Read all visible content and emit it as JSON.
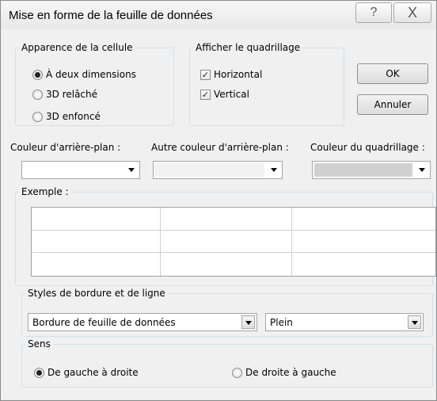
{
  "window": {
    "title": "Mise en forme de la feuille de données",
    "help_icon": "?",
    "close_icon": "X"
  },
  "cell_appearance": {
    "legend": "Apparence de la cellule",
    "options": [
      {
        "label": "À deux dimensions",
        "selected": true
      },
      {
        "label": "3D relâché",
        "selected": false
      },
      {
        "label": "3D enfoncé",
        "selected": false
      }
    ]
  },
  "gridlines": {
    "legend": "Afficher le quadrillage",
    "options": [
      {
        "label": "Horizontal",
        "checked": true
      },
      {
        "label": "Vertical",
        "checked": true
      }
    ]
  },
  "buttons": {
    "ok": "OK",
    "cancel": "Annuler"
  },
  "colors": {
    "background_label": "Couleur d'arrière-plan :",
    "background_value": "#ffffff",
    "alt_background_label": "Autre couleur d'arrière-plan :",
    "alt_background_value": "#f2f2f2",
    "gridline_label": "Couleur du quadrillage :",
    "gridline_value": "#d0d0d0"
  },
  "example": {
    "legend": "Exemple :"
  },
  "border_styles": {
    "legend": "Styles de bordure et de ligne",
    "border_select": "Bordure de feuille de données",
    "line_select": "Plein"
  },
  "direction": {
    "legend": "Sens",
    "options": [
      {
        "label": "De gauche à droite",
        "selected": true
      },
      {
        "label": "De droite à gauche",
        "selected": false
      }
    ]
  }
}
